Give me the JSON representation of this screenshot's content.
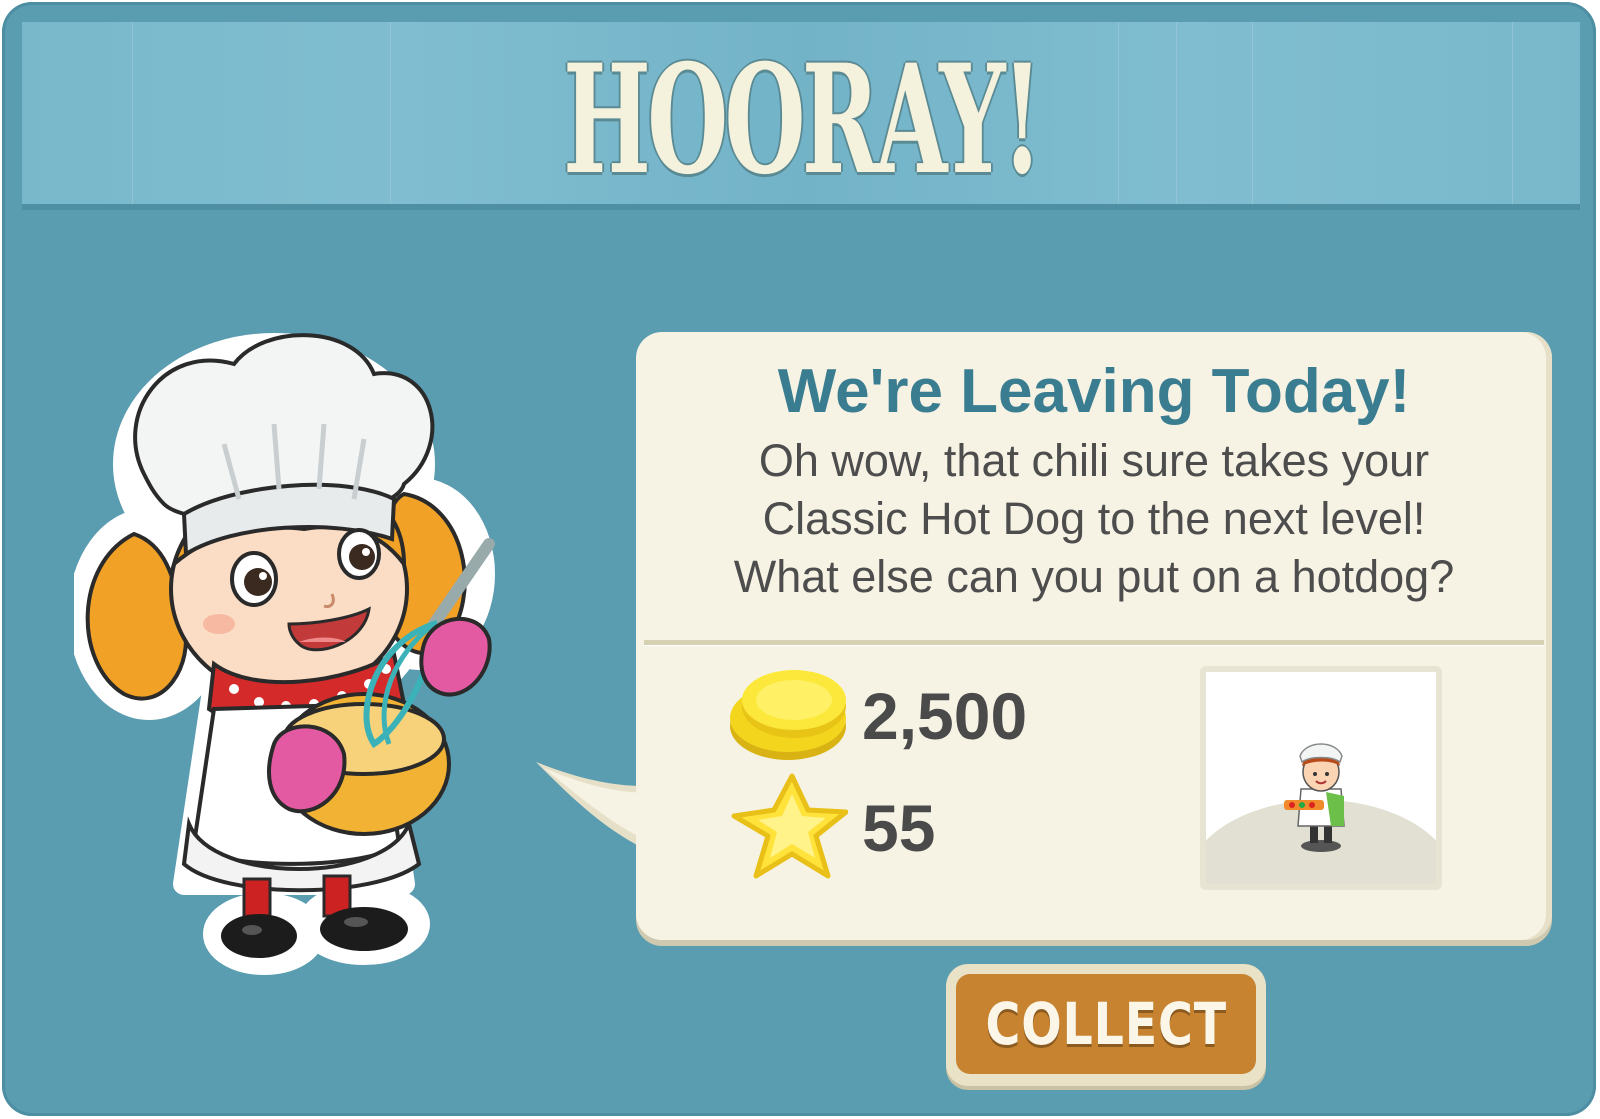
{
  "header": {
    "title": "HOORAY!"
  },
  "message": {
    "title": "We're Leaving Today!",
    "lines": [
      "Oh wow, that chili sure takes your",
      "Classic Hot Dog to the next level!",
      "What else can you put on a hotdog?"
    ]
  },
  "rewards": {
    "coins": "2,500",
    "xp": "55"
  },
  "actions": {
    "collect_label": "COLLECT"
  },
  "colors": {
    "background": "#5a9cb0",
    "banner": "#79b8cb",
    "title_text": "#f4f1dc",
    "message_title": "#3a7d91",
    "bubble": "#f7f3e4",
    "button": "#c7832f"
  },
  "icons": [
    "chef-character-icon",
    "coin-stack-icon",
    "star-icon",
    "chef-reward-item-icon"
  ]
}
